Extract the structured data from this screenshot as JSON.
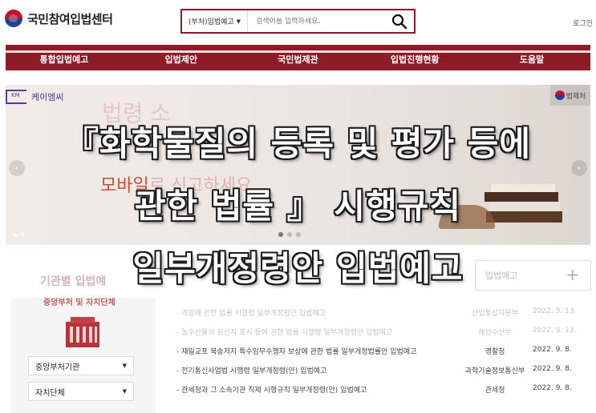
{
  "header": {
    "site_title": "국민참여입법센터",
    "search_select": "(부처)입법예고",
    "search_placeholder": "검색어를 입력하세요.",
    "login": "로그인"
  },
  "nav": {
    "items": [
      "통합입법예고",
      "입법제안",
      "국민법제관",
      "입법진행현황",
      "도움말"
    ]
  },
  "banner": {
    "km_logo": "케이엠씨",
    "km_mark": "KM",
    "ghost_line1": "법령 소",
    "ghost_line2_prefix": "모바일",
    "ghost_line2_suffix": "로 신고하세요.",
    "gov_badge": "법제처",
    "pager": "▶ II"
  },
  "agency": {
    "title": "기관별 입법예",
    "subtitle": "중앙부처 및 자치단체",
    "select1": "중앙부처기관",
    "select2": "자치단체"
  },
  "tab": {
    "label": "입법예고"
  },
  "notices": [
    {
      "title": "- 계량에 관한 법률 시행령 일부개정령안 입법예고",
      "agency": "산업통상자원부",
      "date": "2022. 9. 13."
    },
    {
      "title": "- 농수산물의 원산지 표시 등에 관한 법률 시행령 일부개정령안 입법예고",
      "agency": "해양수산부",
      "date": "2022. 9. 13."
    },
    {
      "title": "- 재일교포 북송저지 특수임무수행자 보상에 관한 법률 일부개정법률안 입법예고",
      "agency": "경찰청",
      "date": "2022. 9. 8."
    },
    {
      "title": "- 전기통신사업법 시행령 일부개정령(안) 입법예고",
      "agency": "과학기술정보통신부",
      "date": "2022. 9. 8."
    },
    {
      "title": "- 관세청과 그 소속기관 직제 시행규칙 일부개정령(안) 입법예고",
      "agency": "관세청",
      "date": "2022. 9. 8."
    }
  ],
  "caption": {
    "line1": "『화학물질의 등록 및 평가 등에",
    "line2": "관한 법률 』 시행규칙",
    "line3": "일부개정령안 입법예고"
  },
  "colors": {
    "brand": "#8e1b28",
    "accent_purple": "#5a3b91"
  }
}
